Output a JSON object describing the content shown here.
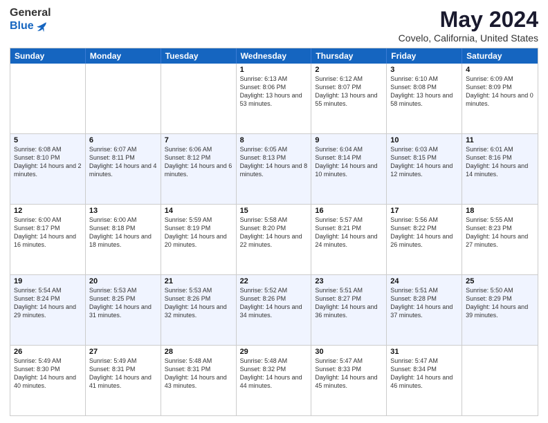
{
  "header": {
    "logo_general": "General",
    "logo_blue": "Blue",
    "title": "May 2024",
    "location": "Covelo, California, United States"
  },
  "weekdays": [
    "Sunday",
    "Monday",
    "Tuesday",
    "Wednesday",
    "Thursday",
    "Friday",
    "Saturday"
  ],
  "rows": [
    [
      {
        "date": "",
        "info": ""
      },
      {
        "date": "",
        "info": ""
      },
      {
        "date": "",
        "info": ""
      },
      {
        "date": "1",
        "info": "Sunrise: 6:13 AM\nSunset: 8:06 PM\nDaylight: 13 hours\nand 53 minutes."
      },
      {
        "date": "2",
        "info": "Sunrise: 6:12 AM\nSunset: 8:07 PM\nDaylight: 13 hours\nand 55 minutes."
      },
      {
        "date": "3",
        "info": "Sunrise: 6:10 AM\nSunset: 8:08 PM\nDaylight: 13 hours\nand 58 minutes."
      },
      {
        "date": "4",
        "info": "Sunrise: 6:09 AM\nSunset: 8:09 PM\nDaylight: 14 hours\nand 0 minutes."
      }
    ],
    [
      {
        "date": "5",
        "info": "Sunrise: 6:08 AM\nSunset: 8:10 PM\nDaylight: 14 hours\nand 2 minutes."
      },
      {
        "date": "6",
        "info": "Sunrise: 6:07 AM\nSunset: 8:11 PM\nDaylight: 14 hours\nand 4 minutes."
      },
      {
        "date": "7",
        "info": "Sunrise: 6:06 AM\nSunset: 8:12 PM\nDaylight: 14 hours\nand 6 minutes."
      },
      {
        "date": "8",
        "info": "Sunrise: 6:05 AM\nSunset: 8:13 PM\nDaylight: 14 hours\nand 8 minutes."
      },
      {
        "date": "9",
        "info": "Sunrise: 6:04 AM\nSunset: 8:14 PM\nDaylight: 14 hours\nand 10 minutes."
      },
      {
        "date": "10",
        "info": "Sunrise: 6:03 AM\nSunset: 8:15 PM\nDaylight: 14 hours\nand 12 minutes."
      },
      {
        "date": "11",
        "info": "Sunrise: 6:01 AM\nSunset: 8:16 PM\nDaylight: 14 hours\nand 14 minutes."
      }
    ],
    [
      {
        "date": "12",
        "info": "Sunrise: 6:00 AM\nSunset: 8:17 PM\nDaylight: 14 hours\nand 16 minutes."
      },
      {
        "date": "13",
        "info": "Sunrise: 6:00 AM\nSunset: 8:18 PM\nDaylight: 14 hours\nand 18 minutes."
      },
      {
        "date": "14",
        "info": "Sunrise: 5:59 AM\nSunset: 8:19 PM\nDaylight: 14 hours\nand 20 minutes."
      },
      {
        "date": "15",
        "info": "Sunrise: 5:58 AM\nSunset: 8:20 PM\nDaylight: 14 hours\nand 22 minutes."
      },
      {
        "date": "16",
        "info": "Sunrise: 5:57 AM\nSunset: 8:21 PM\nDaylight: 14 hours\nand 24 minutes."
      },
      {
        "date": "17",
        "info": "Sunrise: 5:56 AM\nSunset: 8:22 PM\nDaylight: 14 hours\nand 26 minutes."
      },
      {
        "date": "18",
        "info": "Sunrise: 5:55 AM\nSunset: 8:23 PM\nDaylight: 14 hours\nand 27 minutes."
      }
    ],
    [
      {
        "date": "19",
        "info": "Sunrise: 5:54 AM\nSunset: 8:24 PM\nDaylight: 14 hours\nand 29 minutes."
      },
      {
        "date": "20",
        "info": "Sunrise: 5:53 AM\nSunset: 8:25 PM\nDaylight: 14 hours\nand 31 minutes."
      },
      {
        "date": "21",
        "info": "Sunrise: 5:53 AM\nSunset: 8:26 PM\nDaylight: 14 hours\nand 32 minutes."
      },
      {
        "date": "22",
        "info": "Sunrise: 5:52 AM\nSunset: 8:26 PM\nDaylight: 14 hours\nand 34 minutes."
      },
      {
        "date": "23",
        "info": "Sunrise: 5:51 AM\nSunset: 8:27 PM\nDaylight: 14 hours\nand 36 minutes."
      },
      {
        "date": "24",
        "info": "Sunrise: 5:51 AM\nSunset: 8:28 PM\nDaylight: 14 hours\nand 37 minutes."
      },
      {
        "date": "25",
        "info": "Sunrise: 5:50 AM\nSunset: 8:29 PM\nDaylight: 14 hours\nand 39 minutes."
      }
    ],
    [
      {
        "date": "26",
        "info": "Sunrise: 5:49 AM\nSunset: 8:30 PM\nDaylight: 14 hours\nand 40 minutes."
      },
      {
        "date": "27",
        "info": "Sunrise: 5:49 AM\nSunset: 8:31 PM\nDaylight: 14 hours\nand 41 minutes."
      },
      {
        "date": "28",
        "info": "Sunrise: 5:48 AM\nSunset: 8:31 PM\nDaylight: 14 hours\nand 43 minutes."
      },
      {
        "date": "29",
        "info": "Sunrise: 5:48 AM\nSunset: 8:32 PM\nDaylight: 14 hours\nand 44 minutes."
      },
      {
        "date": "30",
        "info": "Sunrise: 5:47 AM\nSunset: 8:33 PM\nDaylight: 14 hours\nand 45 minutes."
      },
      {
        "date": "31",
        "info": "Sunrise: 5:47 AM\nSunset: 8:34 PM\nDaylight: 14 hours\nand 46 minutes."
      },
      {
        "date": "",
        "info": ""
      }
    ]
  ]
}
